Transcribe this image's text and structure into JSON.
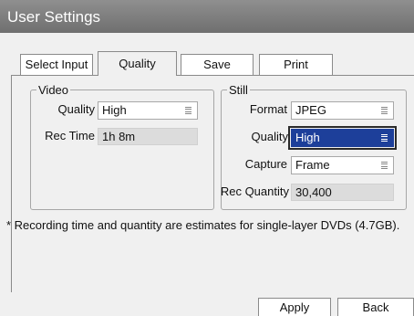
{
  "window": {
    "title": "User Settings"
  },
  "tabs": [
    {
      "label": "Select Input"
    },
    {
      "label": "Quality"
    },
    {
      "label": "Save"
    },
    {
      "label": "Print"
    }
  ],
  "video": {
    "legend": "Video",
    "quality_label": "Quality",
    "quality_value": "High",
    "rec_time_label": "Rec Time",
    "rec_time_value": "1h 8m"
  },
  "still": {
    "legend": "Still",
    "format_label": "Format",
    "format_value": "JPEG",
    "quality_label": "Quality",
    "quality_value": "High",
    "capture_label": "Capture",
    "capture_value": "Frame",
    "rec_quantity_label": "Rec Quantity",
    "rec_quantity_value": "30,400"
  },
  "note": "* Recording time and quantity are estimates for single-layer DVDs (4.7GB).",
  "buttons": {
    "apply": "Apply",
    "back": "Back"
  },
  "colors": {
    "titlebar": "#7a7a7a",
    "focus": "#1d3f9a",
    "window_bg": "#f0f0f0"
  }
}
